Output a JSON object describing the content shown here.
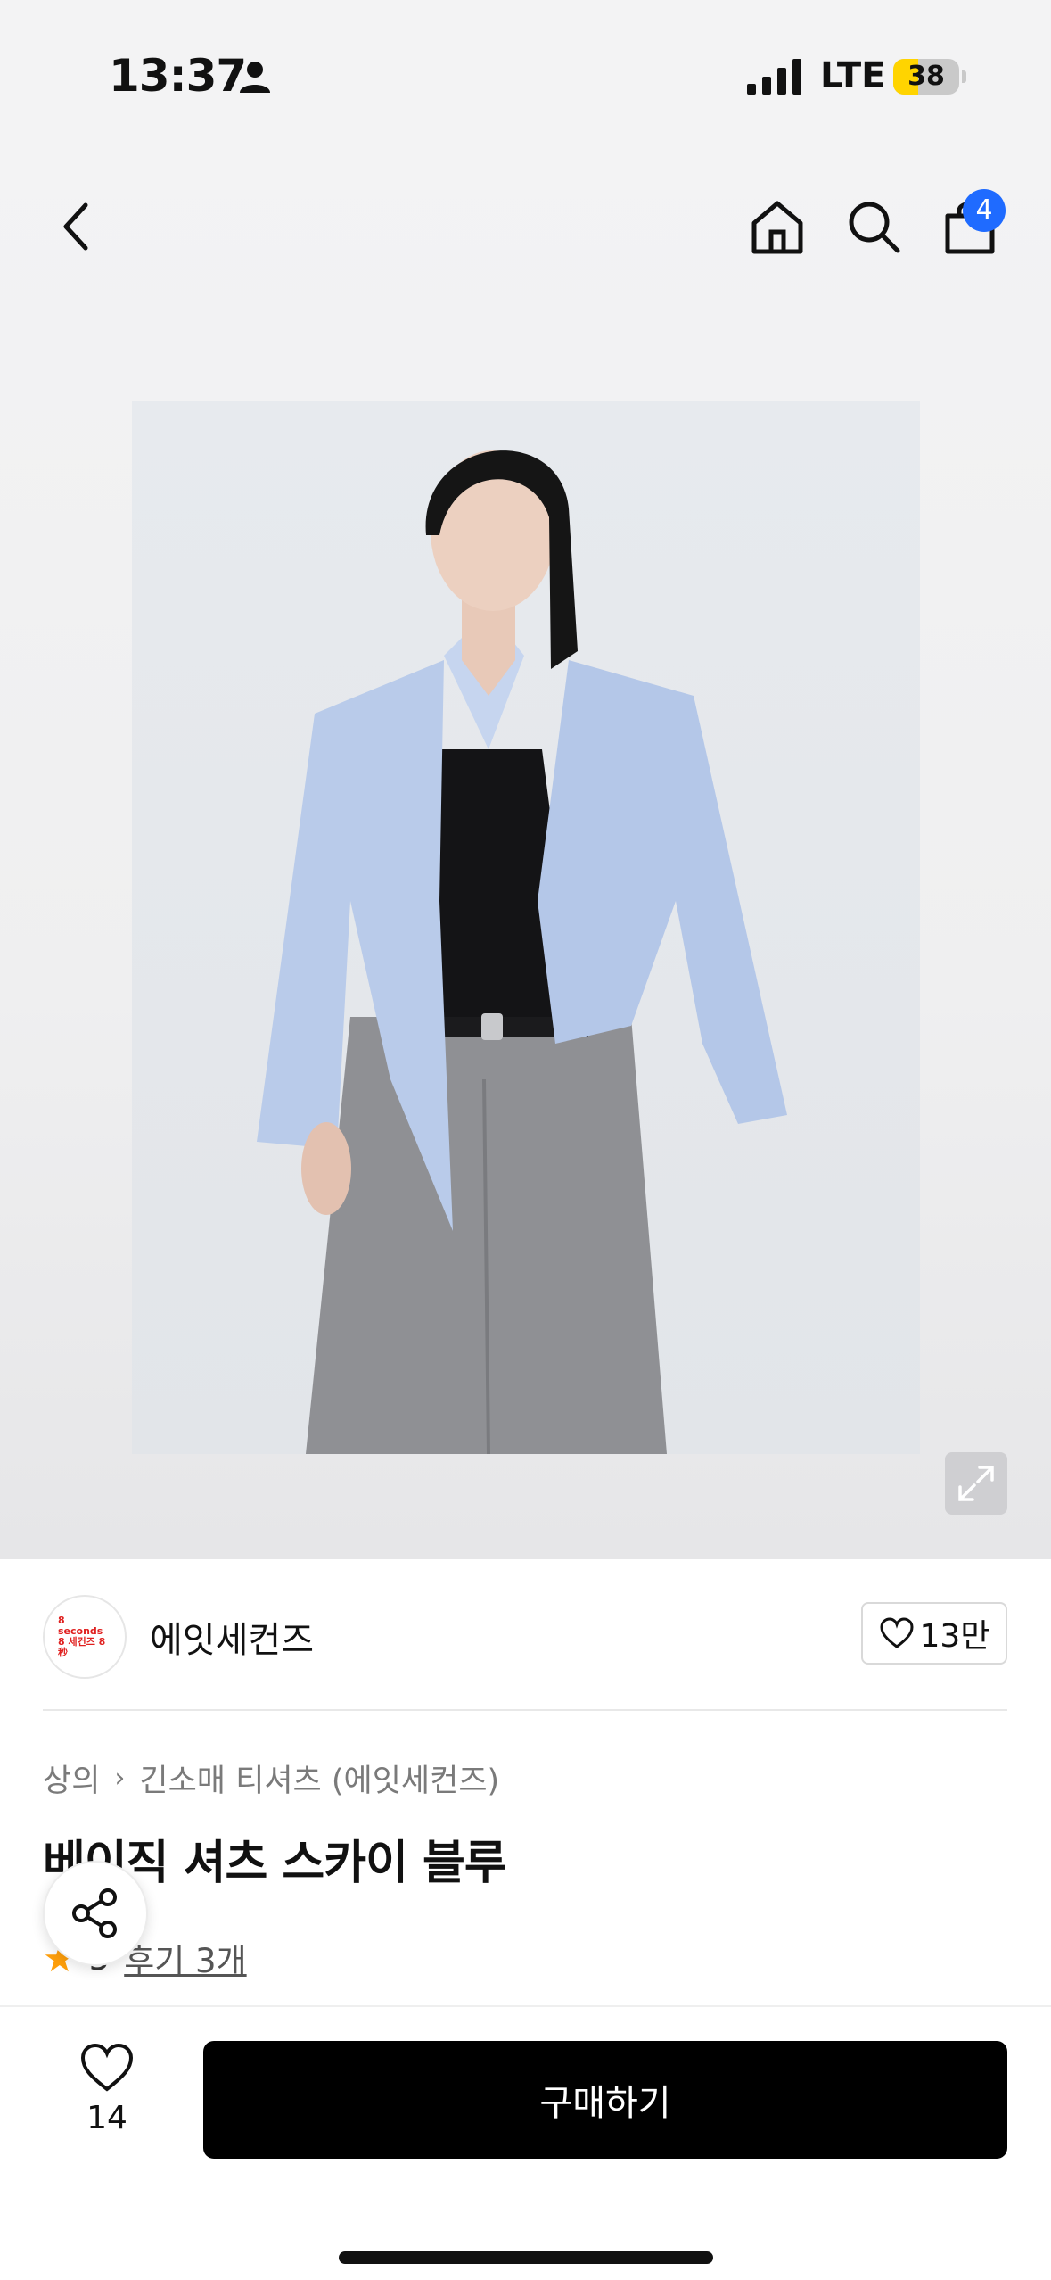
{
  "status_bar": {
    "time": "13:37",
    "network": "LTE",
    "battery_level": "38",
    "battery_percent": 38,
    "battery_color": "#ffd400"
  },
  "nav": {
    "back_icon": "chevron-left-icon",
    "home_icon": "home-icon",
    "search_icon": "search-icon",
    "bag_icon": "shopping-bag-icon",
    "cart_count": "4",
    "badge_color": "#1f6bff"
  },
  "hero": {
    "expand_icon": "expand-icon"
  },
  "brand": {
    "logo_text": "8 seconds 8 세컨즈 8 秒",
    "name": "에잇세컨즈",
    "like_count": "13만"
  },
  "product": {
    "breadcrumb": [
      "상의",
      "긴소매 티셔츠 (에잇세컨즈)"
    ],
    "title": "베이직 셔츠 스카이 블루",
    "rating": "5",
    "review_link": "후기 3개"
  },
  "bottom_bar": {
    "wish_count": "14",
    "buy_label": "구매하기",
    "buy_color": "#000000"
  }
}
